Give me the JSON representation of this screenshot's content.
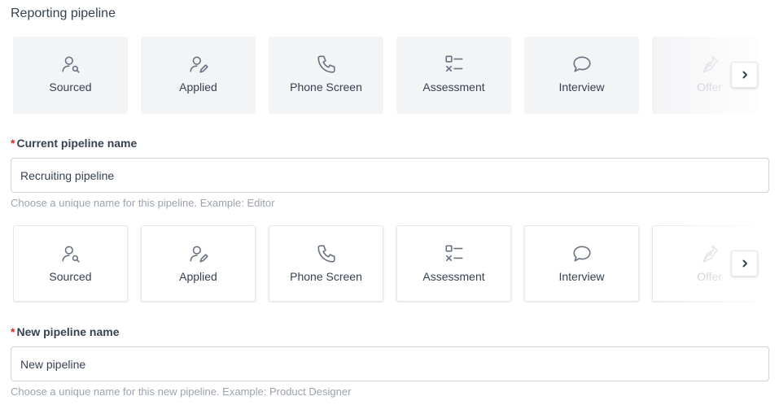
{
  "section_title": "Reporting pipeline",
  "stages": [
    {
      "label": "Sourced",
      "icon": "user-search-icon"
    },
    {
      "label": "Applied",
      "icon": "user-edit-icon"
    },
    {
      "label": "Phone Screen",
      "icon": "phone-icon"
    },
    {
      "label": "Assessment",
      "icon": "checklist-icon"
    },
    {
      "label": "Interview",
      "icon": "chat-bubble-icon"
    },
    {
      "label": "Offer",
      "icon": "pen-nib-icon"
    }
  ],
  "current_pipeline": {
    "required_mark": "*",
    "label": "Current pipeline name",
    "value": "Recruiting pipeline",
    "hint": "Choose a unique name for this pipeline. Example: Editor"
  },
  "new_pipeline": {
    "required_mark": "*",
    "label": "New pipeline name",
    "value": "New pipeline",
    "hint": "Choose a unique name for this new pipeline. Example: Product Designer"
  },
  "colors": {
    "required": "#dc2626",
    "text": "#374151",
    "hint": "#9ca3af",
    "stage_bg": "#f3f4f6"
  }
}
